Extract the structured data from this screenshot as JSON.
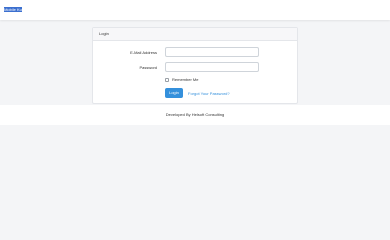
{
  "nav": {
    "brand": "Mobile Ku"
  },
  "login": {
    "header": "Login",
    "email_label": "E-Mail Address",
    "email_value": "",
    "password_label": "Password",
    "password_value": "",
    "remember_label": "Remember Me",
    "submit_label": "Login",
    "forgot_link": "Forgot Your Password?"
  },
  "footer": {
    "text": "Developed By Helsoft Consulting"
  }
}
